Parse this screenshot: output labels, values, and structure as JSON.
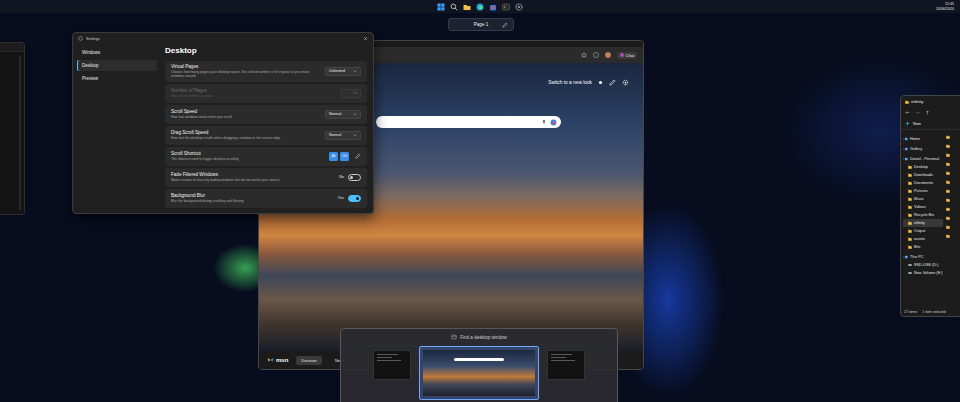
{
  "taskbar": {
    "clock": {
      "time": "12:45",
      "date": "20/06/2024"
    }
  },
  "page_indicator": {
    "label": "Page 1"
  },
  "settings": {
    "title": "Settings",
    "sidebar": [
      {
        "label": "Windows",
        "selected": false
      },
      {
        "label": "Desktop",
        "selected": true
      },
      {
        "label": "Preview",
        "selected": false
      }
    ],
    "heading": "Desktop",
    "rows": [
      {
        "kind": "dropdown",
        "title": "Virtual Pages",
        "description": "Choose how many pages your desktop spans. Set a fixed number or let it grow as you move windows around",
        "value": "Unlimited",
        "disabled": false
      },
      {
        "kind": "number",
        "title": "Number of Pages",
        "description": "Set a fixed number of pages",
        "value": "10",
        "disabled": true
      },
      {
        "kind": "dropdown",
        "title": "Scroll Speed",
        "description": "How fast windows move when you scroll",
        "value": "Normal",
        "disabled": false
      },
      {
        "kind": "dropdown",
        "title": "Drag Scroll Speed",
        "description": "How fast the desktop scrolls when dragging a window to the screen edge",
        "value": "Normal",
        "disabled": false
      },
      {
        "kind": "shortcut",
        "title": "Scroll Shortcut",
        "description": "The shortcut used to trigger desktop scrolling",
        "keys": [
          "Alt",
          "Ctrl"
        ],
        "disabled": false
      },
      {
        "kind": "toggle",
        "title": "Fade Filtered Windows",
        "description": "Make it easier to focus by fading windows that do not match your search",
        "value": "No",
        "on": false,
        "disabled": false
      },
      {
        "kind": "toggle",
        "title": "Background Blur",
        "description": "Blur the background during scrolling and filtering",
        "value": "Yes",
        "on": true,
        "disabled": false
      }
    ]
  },
  "browser": {
    "chat": "Chat",
    "banner": "Switch to a new look",
    "logo": "msn",
    "footer_tabs": [
      {
        "label": "Discover",
        "selected": true
      },
      {
        "label": "News",
        "selected": false
      }
    ]
  },
  "explorer": {
    "title": "infinity",
    "new_button": "New",
    "nav": [
      {
        "label": "Home",
        "kind": "root",
        "selected": false
      },
      {
        "label": "Gallery",
        "kind": "root",
        "selected": false
      },
      {
        "label": "Daniel - Personal",
        "kind": "root",
        "selected": false
      },
      {
        "label": "Desktop",
        "kind": "folder",
        "selected": false
      },
      {
        "label": "Downloads",
        "kind": "folder",
        "selected": false
      },
      {
        "label": "Documents",
        "kind": "folder",
        "selected": false
      },
      {
        "label": "Pictures",
        "kind": "folder",
        "selected": false
      },
      {
        "label": "Music",
        "kind": "folder",
        "selected": false
      },
      {
        "label": "Videos",
        "kind": "folder",
        "selected": false
      },
      {
        "label": "Recycle Bin",
        "kind": "folder",
        "selected": false
      },
      {
        "label": "infinity",
        "kind": "folder",
        "selected": true
      },
      {
        "label": "Output",
        "kind": "folder",
        "selected": false
      },
      {
        "label": "assets",
        "kind": "folder",
        "selected": false
      },
      {
        "label": "Bits",
        "kind": "folder",
        "selected": false
      },
      {
        "label": "This PC",
        "kind": "root",
        "selected": false
      },
      {
        "label": "SSD-USB (D:)",
        "kind": "drive",
        "selected": false
      },
      {
        "label": "New Volume (E:)",
        "kind": "drive",
        "selected": false
      }
    ],
    "status": {
      "items": "17 items",
      "selection": "1 item selected"
    }
  },
  "window_finder": {
    "placeholder": "Find a desktop window",
    "thumbnails": [
      {
        "kind": "terminal",
        "selected": false
      },
      {
        "kind": "browser",
        "selected": true
      },
      {
        "kind": "terminal",
        "selected": false
      }
    ]
  }
}
